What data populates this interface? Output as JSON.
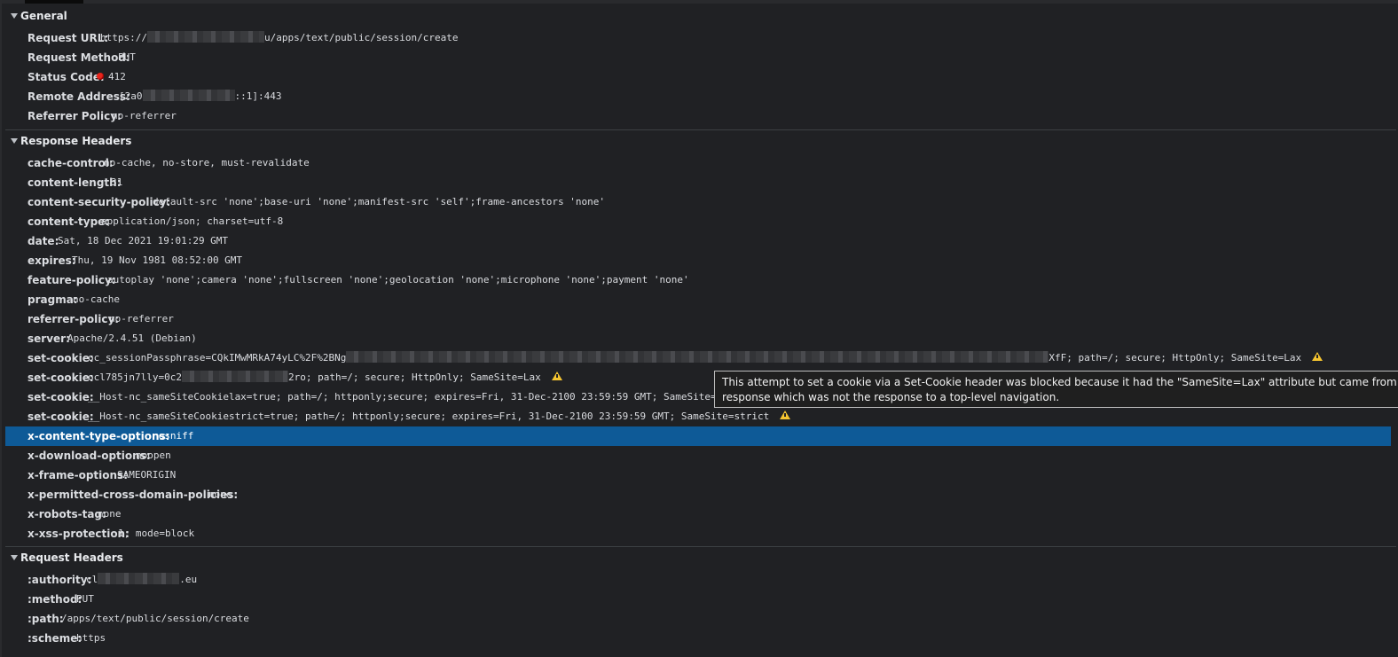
{
  "general": {
    "title": "General",
    "rows": [
      {
        "key": "Request URL:",
        "pre": "https://",
        "post": "u/apps/text/public/session/create"
      },
      {
        "key": "Request Method:",
        "value": "PUT"
      },
      {
        "key": "Status Code:",
        "value": "412"
      },
      {
        "key": "Remote Address:",
        "pre": "[2a0",
        "post": "::1]:443"
      },
      {
        "key": "Referrer Policy:",
        "value": "no-referrer"
      }
    ]
  },
  "response_headers": {
    "title": "Response Headers",
    "rows": [
      {
        "key": "cache-control:",
        "value": "no-cache, no-store, must-revalidate"
      },
      {
        "key": "content-length:",
        "value": "31"
      },
      {
        "key": "content-security-policy:",
        "value": "default-src 'none';base-uri 'none';manifest-src 'self';frame-ancestors 'none'"
      },
      {
        "key": "content-type:",
        "value": "application/json; charset=utf-8"
      },
      {
        "key": "date:",
        "value": "Sat, 18 Dec 2021 19:01:29 GMT"
      },
      {
        "key": "expires:",
        "value": "Thu, 19 Nov 1981 08:52:00 GMT"
      },
      {
        "key": "feature-policy:",
        "value": "autoplay 'none';camera 'none';fullscreen 'none';geolocation 'none';microphone 'none';payment 'none'"
      },
      {
        "key": "pragma:",
        "value": "no-cache"
      },
      {
        "key": "referrer-policy:",
        "value": "no-referrer"
      },
      {
        "key": "server:",
        "value": "Apache/2.4.51 (Debian)"
      },
      {
        "key": "set-cookie:",
        "pre": "oc_sessionPassphrase=CQkIMwMRkA74yLC%2F%2BNg",
        "post": "XfF; path=/; secure; HttpOnly; SameSite=Lax"
      },
      {
        "key": "set-cookie:",
        "pre": "ocl785jn7lly=0c2",
        "post": "2ro; path=/; secure; HttpOnly; SameSite=Lax"
      },
      {
        "key": "set-cookie:",
        "value": "__Host-nc_sameSiteCookielax=true; path=/; httponly;secure; expires=Fri, 31-Dec-2100 23:59:59 GMT; SameSite=lax"
      },
      {
        "key": "set-cookie:",
        "value": "__Host-nc_sameSiteCookiestrict=true; path=/; httponly;secure; expires=Fri, 31-Dec-2100 23:59:59 GMT; SameSite=strict"
      },
      {
        "key": "x-content-type-options:",
        "value": "nosniff"
      },
      {
        "key": "x-download-options:",
        "value": "noopen"
      },
      {
        "key": "x-frame-options:",
        "value": "SAMEORIGIN"
      },
      {
        "key": "x-permitted-cross-domain-policies:",
        "value": "none"
      },
      {
        "key": "x-robots-tag:",
        "value": "none"
      },
      {
        "key": "x-xss-protection:",
        "value": "1; mode=block"
      }
    ]
  },
  "request_headers": {
    "title": "Request Headers",
    "rows": [
      {
        "key": ":authority:",
        "pre": "cl",
        "post": ".eu"
      },
      {
        "key": ":method:",
        "value": "PUT"
      },
      {
        "key": ":path:",
        "value": "/apps/text/public/session/create"
      },
      {
        "key": ":scheme:",
        "value": "https"
      }
    ]
  },
  "tooltip": {
    "line1": "This attempt to set a cookie via a Set-Cookie header was blocked because it had the \"SameSite=Lax\" attribute but came from a cross-site",
    "line2": "response which was not the response to a top-level navigation."
  },
  "colors": {
    "selected_row": "#0e5a97",
    "background": "#202124",
    "warning": "#f4c430",
    "status_error": "#e8251c"
  },
  "icons": {
    "warning": "warning-triangle-icon",
    "status": "status-error-dot-icon",
    "expand": "triangle-down-icon"
  }
}
